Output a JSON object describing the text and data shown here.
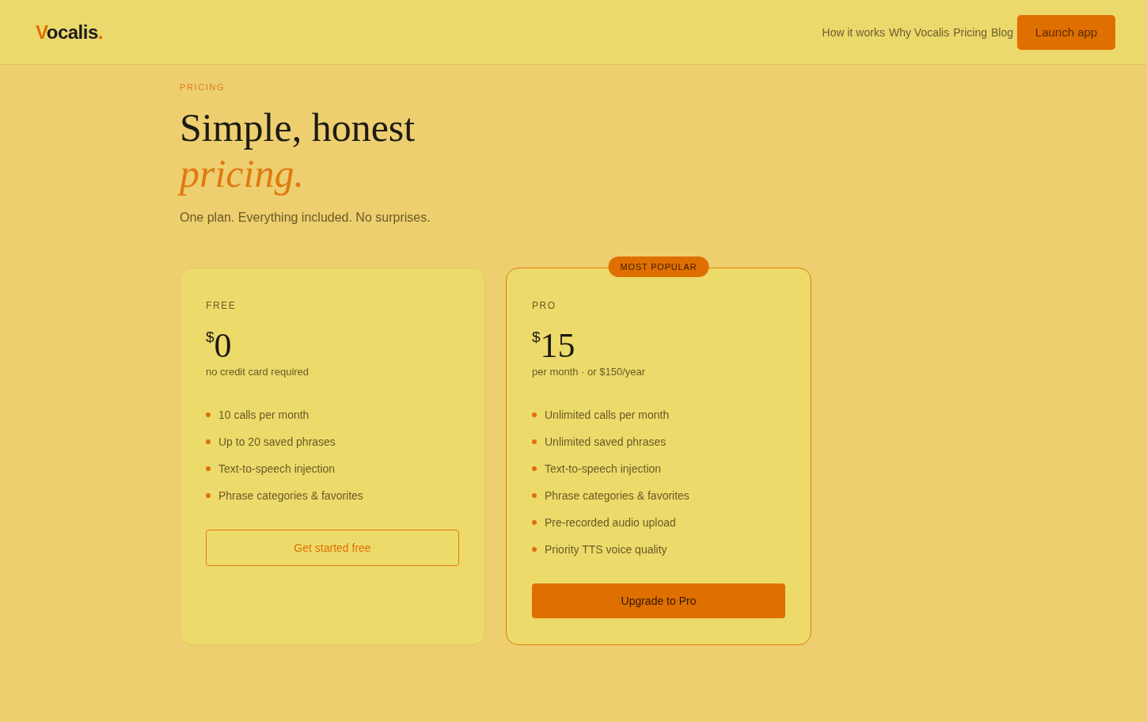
{
  "header": {
    "logo": [
      {
        "text": "V",
        "accent": true
      },
      {
        "text": "ocalis",
        "accent": false
      },
      {
        "text": ".",
        "accent": true
      }
    ],
    "nav": [
      "How it works",
      "Why Vocalis",
      "Pricing",
      "Blog"
    ],
    "cta": "Launch app"
  },
  "hero": {
    "eyebrow": "PRICING",
    "title": "Simple, honest",
    "title_accent": "pricing.",
    "subtitle": "One plan. Everything included. No surprises."
  },
  "plans": [
    {
      "name": "FREE",
      "featured": false,
      "currency": "$",
      "price": "0",
      "note": "no credit card required",
      "features": [
        "10 calls per month",
        "Up to 20 saved phrases",
        "Text-to-speech injection",
        "Phrase categories & favorites"
      ],
      "button": "Get started free"
    },
    {
      "name": "PRO",
      "featured": true,
      "badge": "MOST POPULAR",
      "currency": "$",
      "price": "15",
      "note": "per month · or $150/year",
      "features": [
        "Unlimited calls per month",
        "Unlimited saved phrases",
        "Text-to-speech injection",
        "Phrase categories & favorites",
        "Pre-recorded audio upload",
        "Priority TTS voice quality"
      ],
      "button": "Upgrade to Pro"
    }
  ]
}
